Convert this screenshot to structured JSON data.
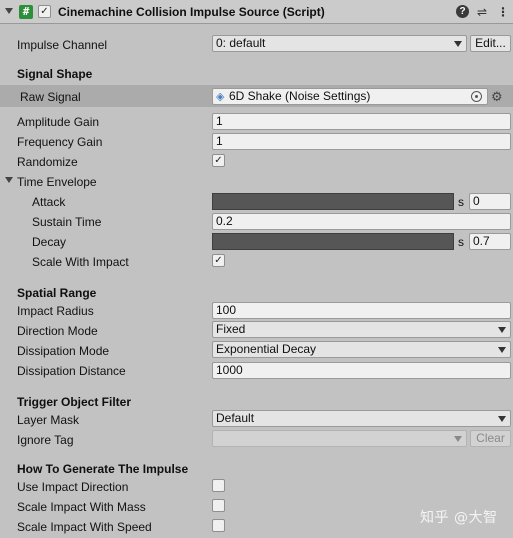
{
  "header": {
    "title": "Cinemachine Collision Impulse Source (Script)",
    "script_icon_glyph": "#",
    "enabled_check": "✓",
    "help_glyph": "?",
    "presets_glyph": "⇌",
    "menu_glyph": "⋮"
  },
  "impulse_channel": {
    "label": "Impulse Channel",
    "value": "0: default",
    "edit_label": "Edit..."
  },
  "signal_shape": {
    "heading": "Signal Shape",
    "raw_signal": {
      "label": "Raw Signal",
      "value": "6D Shake (Noise Settings)"
    },
    "amplitude_gain": {
      "label": "Amplitude Gain",
      "value": "1"
    },
    "frequency_gain": {
      "label": "Frequency Gain",
      "value": "1"
    },
    "randomize": {
      "label": "Randomize",
      "check": "✓"
    }
  },
  "time_envelope": {
    "label": "Time Envelope",
    "attack": {
      "label": "Attack",
      "unit": "s",
      "value": "0"
    },
    "sustain_time": {
      "label": "Sustain Time",
      "value": "0.2"
    },
    "decay": {
      "label": "Decay",
      "unit": "s",
      "value": "0.7"
    },
    "scale_with_impact": {
      "label": "Scale With Impact",
      "check": "✓"
    }
  },
  "spatial_range": {
    "heading": "Spatial Range",
    "impact_radius": {
      "label": "Impact Radius",
      "value": "100"
    },
    "direction_mode": {
      "label": "Direction Mode",
      "value": "Fixed"
    },
    "dissipation_mode": {
      "label": "Dissipation Mode",
      "value": "Exponential Decay"
    },
    "dissipation_distance": {
      "label": "Dissipation Distance",
      "value": "1000"
    }
  },
  "trigger_filter": {
    "heading": "Trigger Object Filter",
    "layer_mask": {
      "label": "Layer Mask",
      "value": "Default"
    },
    "ignore_tag": {
      "label": "Ignore Tag",
      "value": "",
      "clear_label": "Clear"
    }
  },
  "generate_impulse": {
    "heading": "How To Generate The Impulse",
    "use_impact_direction": {
      "label": "Use Impact Direction"
    },
    "scale_impact_with_mass": {
      "label": "Scale Impact With Mass"
    },
    "scale_impact_with_speed": {
      "label": "Scale Impact With Speed"
    }
  },
  "watermark": "知乎 @大智",
  "colors": {
    "background": "#c2c2c2",
    "highlight": "#ababab",
    "script_icon": "#2d8f3a",
    "curve_bar": "#565656"
  }
}
